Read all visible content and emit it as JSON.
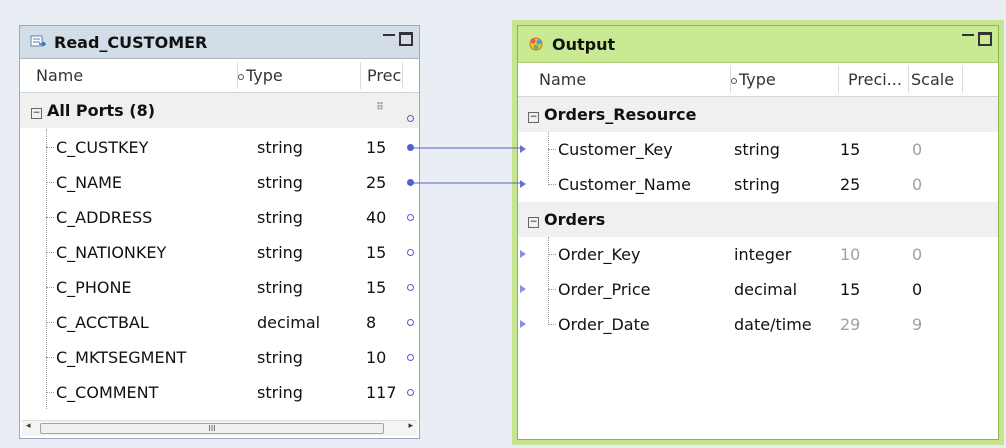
{
  "read_panel": {
    "title": "Read_CUSTOMER",
    "columns": {
      "name": "Name",
      "type": "Type",
      "prec": "Prec"
    },
    "group_label": "All Ports (8)",
    "ports": [
      {
        "name": "C_CUSTKEY",
        "type": "string",
        "prec": "15"
      },
      {
        "name": "C_NAME",
        "type": "string",
        "prec": "25"
      },
      {
        "name": "C_ADDRESS",
        "type": "string",
        "prec": "40"
      },
      {
        "name": "C_NATIONKEY",
        "type": "string",
        "prec": "15"
      },
      {
        "name": "C_PHONE",
        "type": "string",
        "prec": "15"
      },
      {
        "name": "C_ACCTBAL",
        "type": "decimal",
        "prec": "8"
      },
      {
        "name": "C_MKTSEGMENT",
        "type": "string",
        "prec": "10"
      },
      {
        "name": "C_COMMENT",
        "type": "string",
        "prec": "117"
      }
    ],
    "scroll_thumb": "III"
  },
  "output_panel": {
    "title": "Output",
    "columns": {
      "name": "Name",
      "type": "Type",
      "prec": "Preci...",
      "scale": "Scale"
    },
    "groups": [
      {
        "label": "Orders_Resource",
        "ports": [
          {
            "name": "Customer_Key",
            "type": "string",
            "prec": "15",
            "scale": "0"
          },
          {
            "name": "Customer_Name",
            "type": "string",
            "prec": "25",
            "scale": "0"
          }
        ]
      },
      {
        "label": "Orders",
        "ports": [
          {
            "name": "Order_Key",
            "type": "integer",
            "prec": "10",
            "scale": "0"
          },
          {
            "name": "Order_Price",
            "type": "decimal",
            "prec": "15",
            "scale": "0"
          },
          {
            "name": "Order_Date",
            "type": "date/time",
            "prec": "29",
            "scale": "9"
          }
        ]
      }
    ]
  },
  "colors": {
    "link": "#5560cc",
    "output_border": "#c5e68e",
    "title_bg": "#d3dde8"
  }
}
